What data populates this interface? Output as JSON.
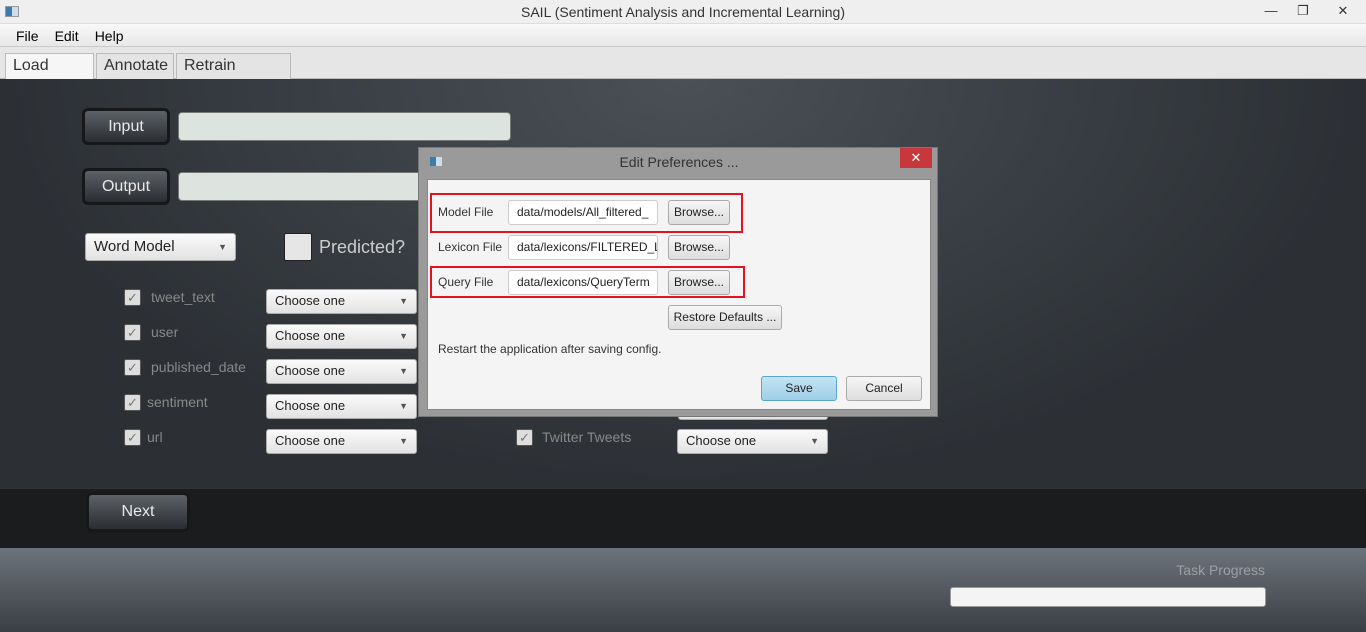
{
  "window": {
    "title": "SAIL (Sentiment Analysis and Incremental Learning)",
    "minimize": "—",
    "restore": "❐",
    "close": "✕"
  },
  "menu": [
    "File",
    "Edit",
    "Help"
  ],
  "tabs": [
    "Load Data",
    "Annotate",
    "Retrain Model"
  ],
  "load": {
    "input_label": "Input",
    "output_label": "Output",
    "input_value": "",
    "output_value": "",
    "model_select": "Word Model",
    "predicted_label": "Predicted?",
    "fields": [
      {
        "name": "tweet_text",
        "checked": true,
        "select": "Choose one"
      },
      {
        "name": "user",
        "checked": true,
        "select": "Choose one"
      },
      {
        "name": "published_date",
        "checked": true,
        "select": "Choose one"
      },
      {
        "name": "sentiment",
        "checked": true,
        "select": "Choose one"
      },
      {
        "name": "url",
        "checked": true,
        "select": "Choose one"
      }
    ],
    "twitter": {
      "label": "Twitter Tweets",
      "checked": true,
      "select": "Choose one"
    },
    "next_label": "Next"
  },
  "progress": {
    "label": "Task Progress",
    "value": 0
  },
  "dialog": {
    "title": "Edit Preferences ...",
    "close": "✕",
    "rows": [
      {
        "label": "Model File",
        "value": "data/models/All_filtered_",
        "browse": "Browse...",
        "highlighted": true
      },
      {
        "label": "Lexicon File",
        "value": "data/lexicons/FILTERED_L",
        "browse": "Browse...",
        "highlighted": false
      },
      {
        "label": "Query File",
        "value": "data/lexicons/QueryTerm",
        "browse": "Browse...",
        "highlighted": true
      }
    ],
    "restore": "Restore Defaults ...",
    "note": "Restart the application after saving config.",
    "save": "Save",
    "cancel": "Cancel"
  },
  "colors": {
    "highlight": "#e3121f",
    "close": "#c7373c",
    "save": "#a9d5ea"
  }
}
